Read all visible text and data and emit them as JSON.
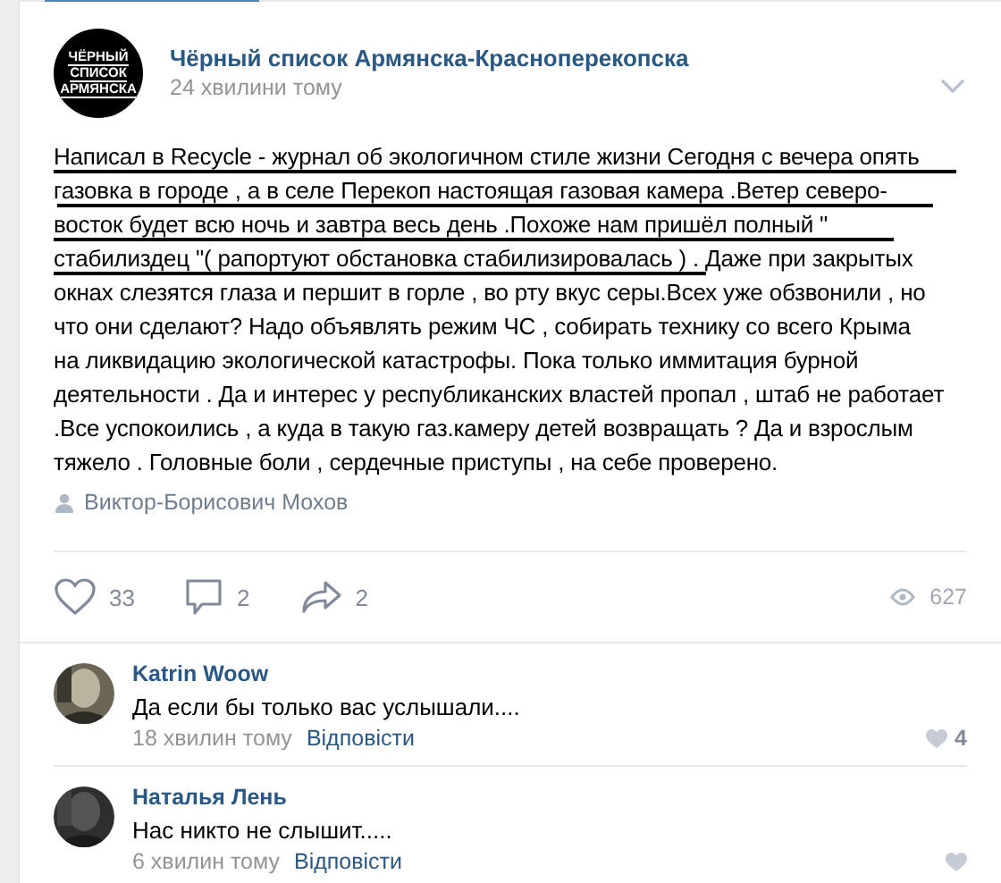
{
  "post": {
    "group_logo": {
      "lines": [
        "ЧЁРНЫЙ",
        "СПИСОК",
        "АРМЯНСКА"
      ]
    },
    "group_name": "Чёрный список Армянска-Красноперекопска",
    "time": "24 хвилини тому",
    "text": "Написал в Recycle - журнал об экологичном стиле жизни Сегодня с вечера опять\nгазовка в городе , а в селе Перекоп настоящая газовая камера .Ветер северо-\nвосток будет всю ночь и завтра весь день .Похоже нам пришёл полный \"\nстабилиздец \"( рапортуют обстановка стабилизировалась ) . Даже при закрытых\nокнах слезятся глаза и першит в горле , во рту вкус серы.Всех уже обзвонили , но\nчто они сделают? Надо объявлять режим ЧС , собирать технику со всего Крыма\nна ликвидацию экологической катастрофы. Пока только иммитация бурной\nдеятельности . Да и интерес у республиканских властей пропал , штаб не работает\n.Все успокоились , а куда в такую газ.камеру детей возвращать ? Да и взрослым\nтяжело . Головные боли , сердечные приступы , на себе проверено.",
    "author": "Виктор-Борисович Мохов",
    "actions": {
      "likes": "33",
      "comments": "2",
      "shares": "2",
      "views": "627"
    }
  },
  "comments": [
    {
      "name": "Katrin Woow",
      "text": "Да если бы только вас услышали....",
      "time": "18 хвилин тому",
      "reply": "Відповісти",
      "likes": "4"
    },
    {
      "name": "Наталья Лень",
      "text": "Нас никто не слышит.....",
      "time": "6 хвилин тому",
      "reply": "Відповісти"
    }
  ]
}
